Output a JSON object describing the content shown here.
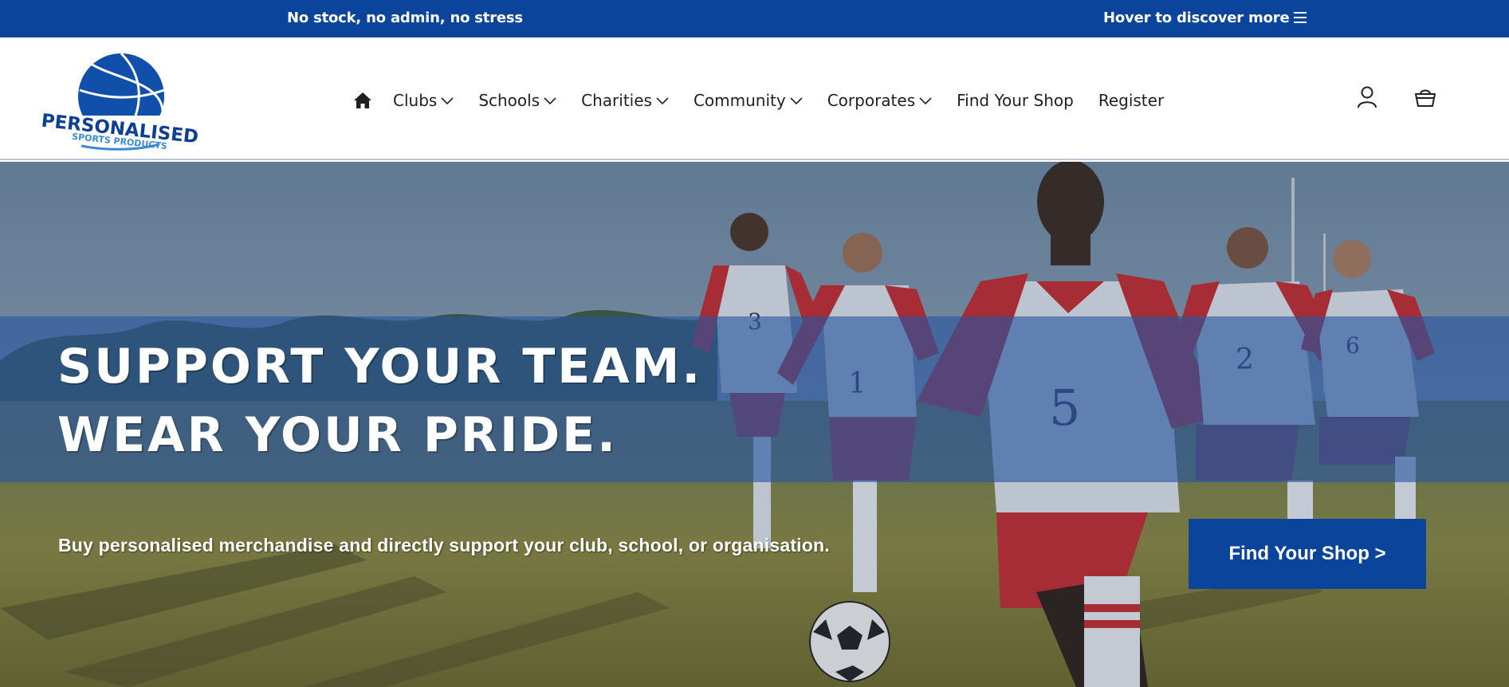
{
  "announcement": {
    "message": "No stock, no admin, no stress",
    "hover_text": "Hover to discover more",
    "menu_icon": "hamburger-menu-icon"
  },
  "header": {
    "logo": {
      "line1": "PERSONALISED",
      "line2": "SPORTS PRODUCTS"
    },
    "nav": {
      "home_icon": "home-icon",
      "items": [
        {
          "label": "Clubs",
          "has_dropdown": true
        },
        {
          "label": "Schools",
          "has_dropdown": true
        },
        {
          "label": "Charities",
          "has_dropdown": true
        },
        {
          "label": "Community",
          "has_dropdown": true
        },
        {
          "label": "Corporates",
          "has_dropdown": true
        },
        {
          "label": "Find Your Shop",
          "has_dropdown": false
        },
        {
          "label": "Register",
          "has_dropdown": false
        }
      ]
    },
    "account_icon": "user-icon",
    "cart_icon": "basket-icon"
  },
  "hero": {
    "headline_line1": "SUPPORT YOUR TEAM.",
    "headline_line2": "WEAR YOUR PRIDE.",
    "subline": "Buy personalised merchandise and directly support your club, school, or organisation.",
    "cta_label": "Find Your Shop >",
    "jersey_numbers": [
      "3",
      "1",
      "5",
      "2",
      "6"
    ]
  },
  "colors": {
    "brand_blue": "#0a449b",
    "band_overlay": "#2956a0",
    "text_dark": "#1f1f1f",
    "jersey_red": "#c42a30",
    "grass": "#8a8a3a"
  }
}
